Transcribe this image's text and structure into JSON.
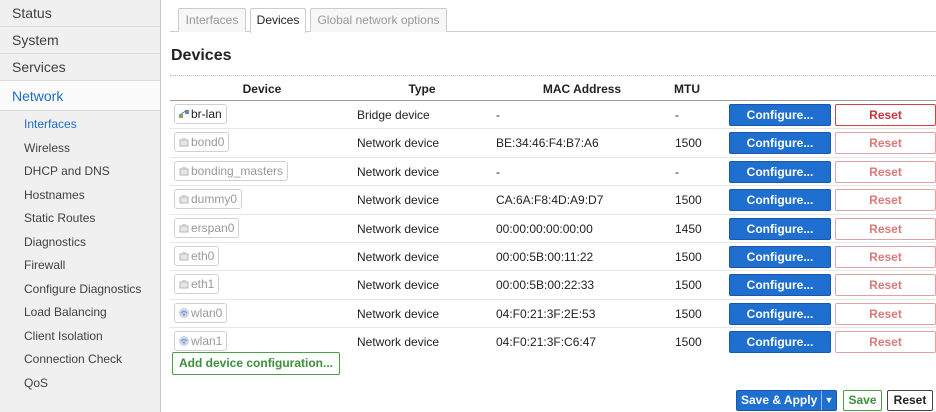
{
  "sidebar": {
    "categories": [
      {
        "label": "Status",
        "name": "sidebar-item-status"
      },
      {
        "label": "System",
        "name": "sidebar-item-system"
      },
      {
        "label": "Services",
        "name": "sidebar-item-services"
      },
      {
        "label": "Network",
        "name": "sidebar-item-network"
      }
    ],
    "network_items": [
      {
        "label": "Interfaces",
        "name": "sidebar-item-interfaces"
      },
      {
        "label": "Wireless",
        "name": "sidebar-item-wireless"
      },
      {
        "label": "DHCP and DNS",
        "name": "sidebar-item-dhcp-and-dns"
      },
      {
        "label": "Hostnames",
        "name": "sidebar-item-hostnames"
      },
      {
        "label": "Static Routes",
        "name": "sidebar-item-static-routes"
      },
      {
        "label": "Diagnostics",
        "name": "sidebar-item-diagnostics"
      },
      {
        "label": "Firewall",
        "name": "sidebar-item-firewall"
      },
      {
        "label": "Configure Diagnostics",
        "name": "sidebar-item-configure-diagnostics"
      },
      {
        "label": "Load Balancing",
        "name": "sidebar-item-load-balancing"
      },
      {
        "label": "Client Isolation",
        "name": "sidebar-item-client-isolation"
      },
      {
        "label": "Connection Check",
        "name": "sidebar-item-connection-check"
      },
      {
        "label": "QoS",
        "name": "sidebar-item-qos"
      }
    ],
    "active_category": "Network",
    "active_item": "Interfaces"
  },
  "tabs": [
    {
      "label": "Interfaces",
      "active": false
    },
    {
      "label": "Devices",
      "active": true
    },
    {
      "label": "Global network options",
      "active": false
    }
  ],
  "section_title": "Devices",
  "columns": {
    "device": "Device",
    "type": "Type",
    "mac": "MAC Address",
    "mtu": "MTU"
  },
  "devices": [
    {
      "name": "br-lan",
      "icon": "bridge-icon",
      "active": true,
      "type": "Bridge device",
      "mac": "-",
      "mtu": "-",
      "reset_enabled": true
    },
    {
      "name": "bond0",
      "icon": "ethernet-port-icon",
      "active": false,
      "type": "Network device",
      "mac": "BE:34:46:F4:B7:A6",
      "mtu": "1500",
      "reset_enabled": false
    },
    {
      "name": "bonding_masters",
      "icon": "ethernet-port-icon",
      "active": false,
      "type": "Network device",
      "mac": "-",
      "mtu": "-",
      "reset_enabled": false
    },
    {
      "name": "dummy0",
      "icon": "ethernet-port-icon",
      "active": false,
      "type": "Network device",
      "mac": "CA:6A:F8:4D:A9:D7",
      "mtu": "1500",
      "reset_enabled": false
    },
    {
      "name": "erspan0",
      "icon": "ethernet-port-icon",
      "active": false,
      "type": "Network device",
      "mac": "00:00:00:00:00:00",
      "mtu": "1450",
      "reset_enabled": false
    },
    {
      "name": "eth0",
      "icon": "ethernet-port-icon",
      "active": false,
      "type": "Network device",
      "mac": "00:00:5B:00:11:22",
      "mtu": "1500",
      "reset_enabled": false
    },
    {
      "name": "eth1",
      "icon": "ethernet-port-icon",
      "active": false,
      "type": "Network device",
      "mac": "00:00:5B:00:22:33",
      "mtu": "1500",
      "reset_enabled": false
    },
    {
      "name": "wlan0",
      "icon": "wifi-icon",
      "active": false,
      "type": "Network device",
      "mac": "04:F0:21:3F:2E:53",
      "mtu": "1500",
      "reset_enabled": false
    },
    {
      "name": "wlan1",
      "icon": "wifi-icon",
      "active": false,
      "type": "Network device",
      "mac": "04:F0:21:3F:C6:47",
      "mtu": "1500",
      "reset_enabled": false
    }
  ],
  "row_buttons": {
    "configure": "Configure...",
    "reset": "Reset"
  },
  "add_device_label": "Add device configuration...",
  "footer": {
    "save_apply": "Save & Apply",
    "save_apply_dropdown": "▼",
    "save": "Save",
    "reset": "Reset"
  },
  "colors": {
    "accent_blue": "#1f6fd1",
    "reset_red": "#c8333c",
    "save_green": "#3a913a",
    "active_nav": "#1d6bc9"
  }
}
